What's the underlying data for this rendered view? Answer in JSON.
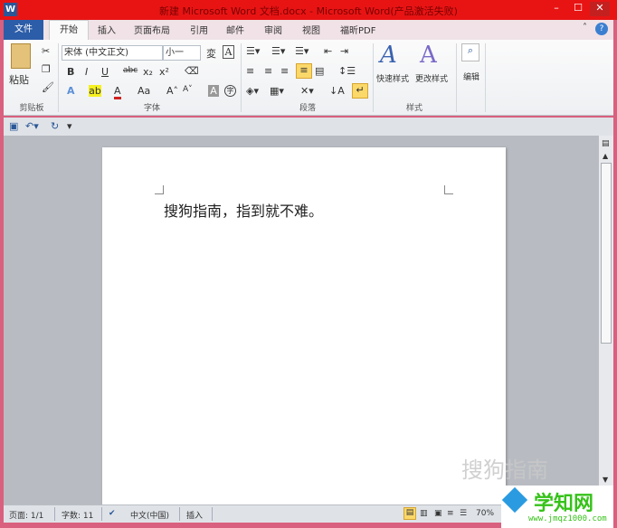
{
  "window": {
    "title": "新建 Microsoft Word 文档.docx - Microsoft Word(产品激活失败)",
    "app_icon": "W",
    "minimize": "–",
    "maximize": "☐",
    "close": "✕"
  },
  "tabs": [
    {
      "label": "文件"
    },
    {
      "label": "开始"
    },
    {
      "label": "插入"
    },
    {
      "label": "页面布局"
    },
    {
      "label": "引用"
    },
    {
      "label": "邮件"
    },
    {
      "label": "审阅"
    },
    {
      "label": "视图"
    },
    {
      "label": "福昕PDF"
    }
  ],
  "ribbon": {
    "clipboard": {
      "paste": "粘贴",
      "group": "剪贴板"
    },
    "font": {
      "font_name": "宋体 (中文正文)",
      "font_size": "小一",
      "group": "字体",
      "bold": "B",
      "italic": "I",
      "underline": "U",
      "strike": "abc",
      "sub": "x₂",
      "sup": "x²",
      "color": "A",
      "case": "Aa",
      "grow": "A˄",
      "shrink": "A˅",
      "shade": "A",
      "enclose": "字"
    },
    "paragraph": {
      "group": "段落"
    },
    "styles": {
      "quick": "快速样式",
      "change": "更改样式",
      "group": "样式"
    },
    "edit": {
      "label": "编辑"
    }
  },
  "document": {
    "text": "搜狗指南，指到就不难。"
  },
  "status": {
    "page": "页面: 1/1",
    "words": "字数: 11",
    "lang": "中文(中国)",
    "mode": "插入",
    "zoom": "70%"
  },
  "watermark": {
    "text": "搜狗指南",
    "site": "学知网",
    "url": "www.jmqz1000.com"
  },
  "colors": {
    "title_bar": "#e81414",
    "file_tab": "#2c5da8",
    "frame": "#d9607e"
  }
}
